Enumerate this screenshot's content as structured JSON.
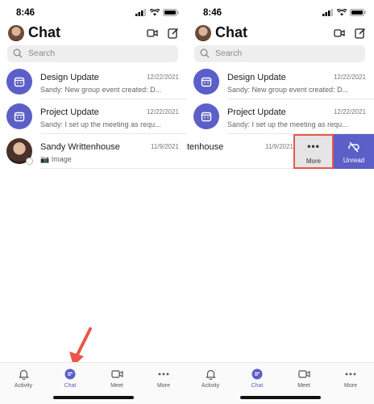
{
  "left": {
    "status_time": "8:46",
    "title": "Chat",
    "search_placeholder": "Search",
    "chats": [
      {
        "name": "Design Update",
        "date": "12/22/2021",
        "preview": "Sandy: New group event created: D..."
      },
      {
        "name": "Project Update",
        "date": "12/22/2021",
        "preview": "Sandy: I set up the meeting as requ..."
      },
      {
        "name": "Sandy Writtenhouse",
        "date": "11/9/2021",
        "preview": "📷 Image"
      }
    ],
    "tabs": [
      {
        "label": "Activity"
      },
      {
        "label": "Chat"
      },
      {
        "label": "Meet"
      },
      {
        "label": "More"
      }
    ]
  },
  "right": {
    "status_time": "8:46",
    "title": "Chat",
    "search_placeholder": "Search",
    "chats": [
      {
        "name": "Design Update",
        "date": "12/22/2021",
        "preview": "Sandy: New group event created: D..."
      },
      {
        "name": "Project Update",
        "date": "12/22/2021",
        "preview": "Sandy: I set up the meeting as requ..."
      },
      {
        "name": "tenhouse",
        "date": "11/9/2021"
      }
    ],
    "swipe_actions": {
      "more_label": "More",
      "unread_label": "Unread"
    },
    "tabs": [
      {
        "label": "Activity"
      },
      {
        "label": "Chat"
      },
      {
        "label": "Meet"
      },
      {
        "label": "More"
      }
    ]
  },
  "colors": {
    "accent": "#5b5fc7",
    "highlight": "#e8574a"
  }
}
